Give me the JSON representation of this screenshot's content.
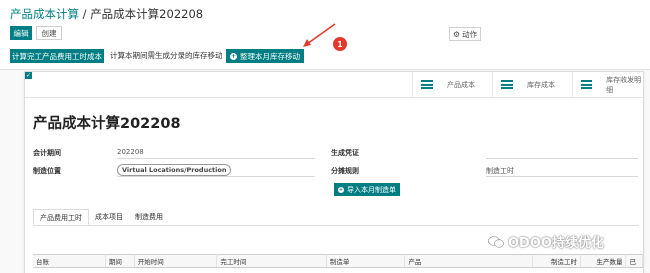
{
  "breadcrumb": {
    "parent": "产品成本计算",
    "separator": " / ",
    "current": "产品成本计算202208"
  },
  "toolbar": {
    "edit_label": "编辑",
    "create_label": "创建",
    "action_label": "动作",
    "action_icon": "gear-icon"
  },
  "header_buttons": {
    "compute_label": "计算完工产品费用工时成本",
    "hint_text": "计算本期间需生成分录的库存移动",
    "move_label": "整理本月库存移动"
  },
  "annotation": {
    "badge_number": "1",
    "color": "#e23a2c"
  },
  "smart_buttons": [
    {
      "label": "产品成本",
      "icon": "list-icon"
    },
    {
      "label": "库存成本",
      "icon": "list-icon"
    },
    {
      "label": "库存收发明细",
      "icon": "list-icon"
    }
  ],
  "form": {
    "title": "产品成本计算202208",
    "period_label": "会计期间",
    "period_value": "202208",
    "location_label": "制造位置",
    "location_value": "Virtual Locations/Production",
    "voucher_label": "生成凭证",
    "voucher_checked": true,
    "rule_label": "分摊规则",
    "rule_value": "制造工时",
    "import_label": "导入本月制造单"
  },
  "tabs": [
    {
      "label": "产品费用工时",
      "active": true
    },
    {
      "label": "成本项目",
      "active": false
    },
    {
      "label": "制造费用",
      "active": false
    }
  ],
  "table": {
    "columns": [
      "台账",
      "期间",
      "开始时间",
      "完工时间",
      "制造单",
      "产品",
      "制造工时",
      "生产数量",
      "已"
    ]
  },
  "watermark": {
    "text": "ODOO持续优化"
  },
  "colors": {
    "primary": "#017e84",
    "badge": "#e23a2c"
  }
}
